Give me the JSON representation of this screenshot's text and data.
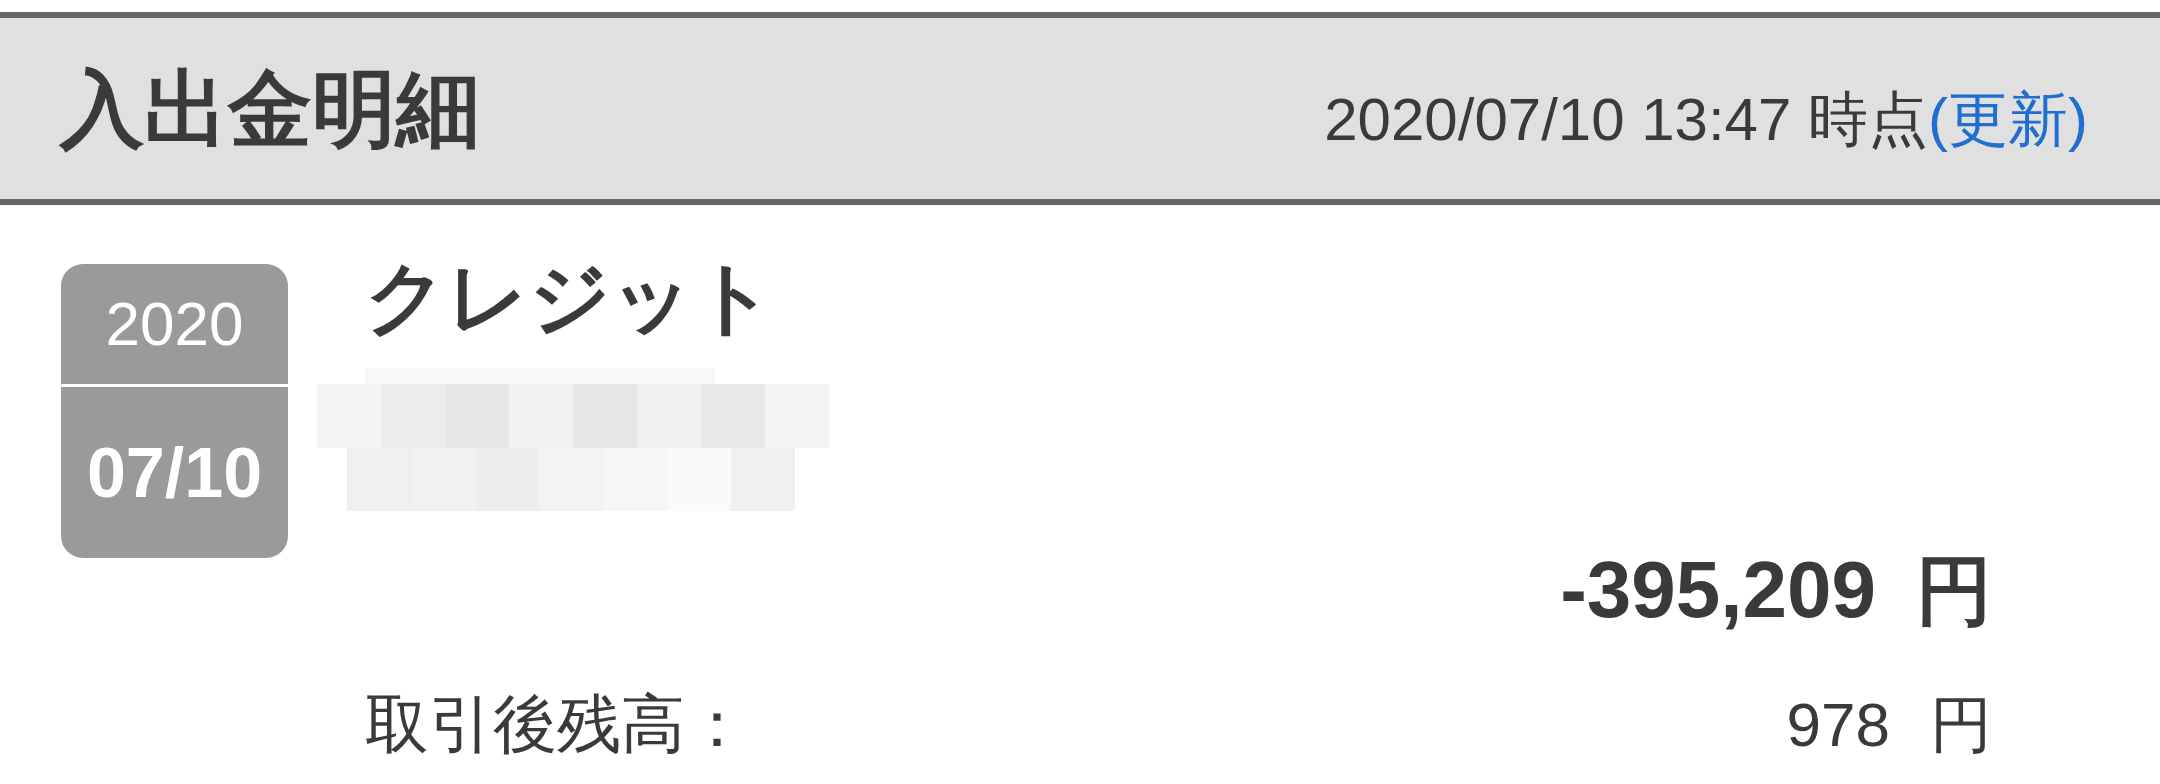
{
  "header": {
    "title": "入出金明細",
    "timestamp": "2020/07/10 13:47 時点",
    "refresh_link": "(更新)"
  },
  "transactions": [
    {
      "date": {
        "year": "2020",
        "day": "07/10"
      },
      "description": "クレジット",
      "amount": "-395,209",
      "amount_unit": "円",
      "balance_label": "取引後残高：",
      "balance": "978",
      "balance_unit": "円"
    }
  ]
}
